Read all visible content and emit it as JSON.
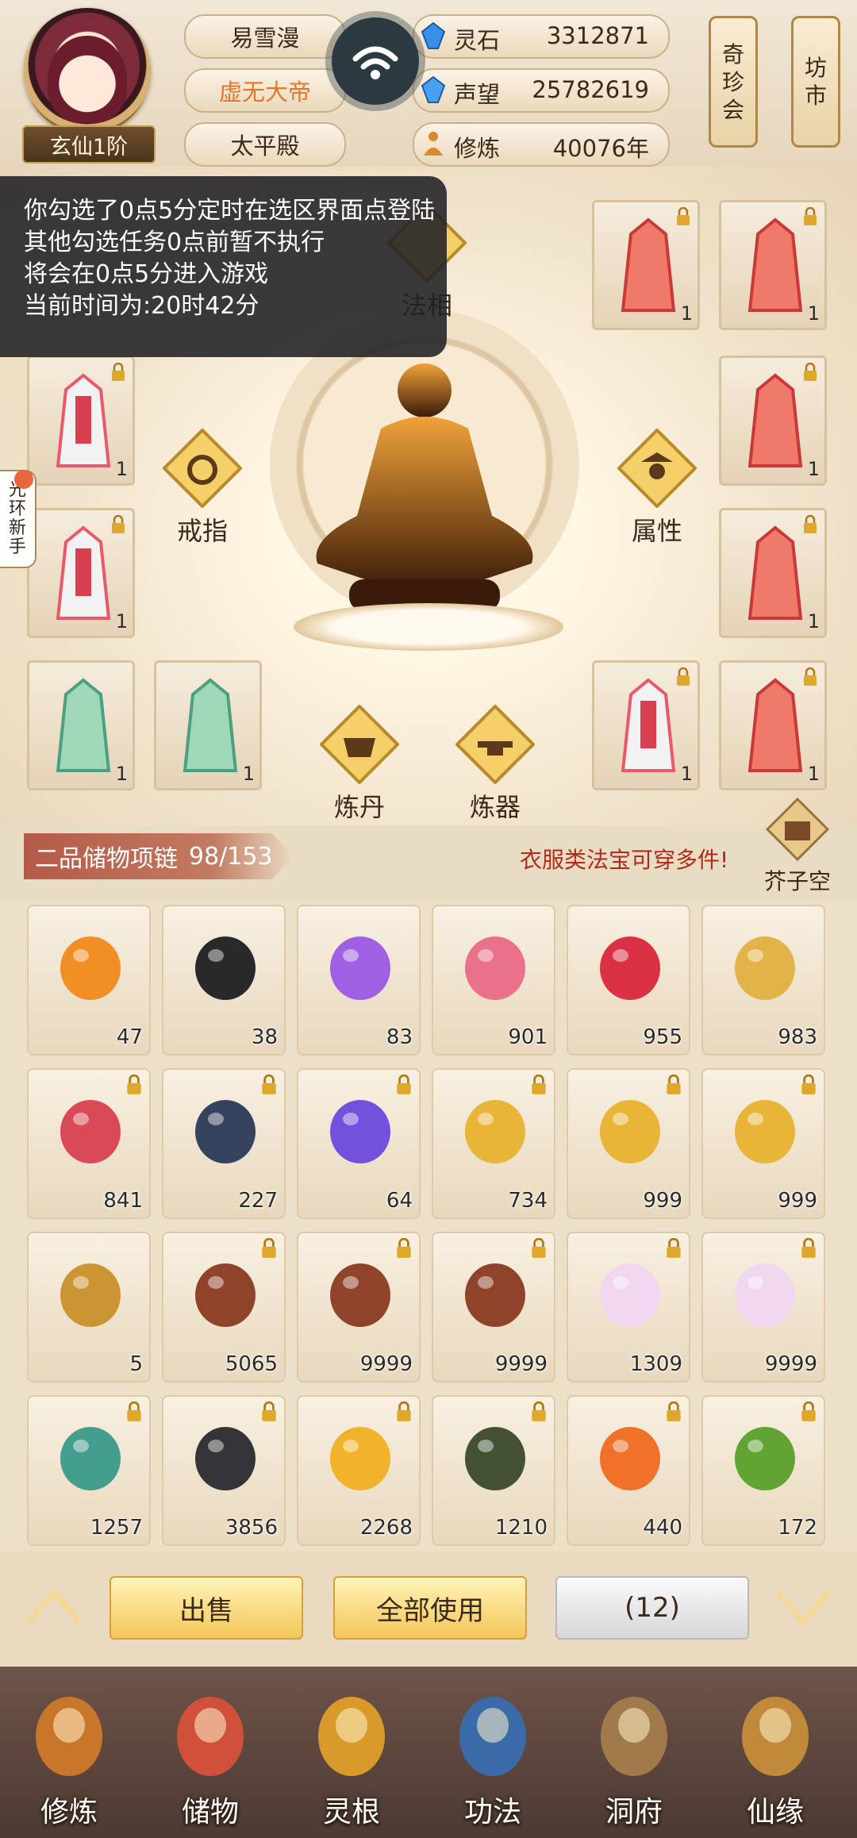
{
  "header": {
    "realm_badge": "玄仙1阶",
    "names": [
      "易雪漫",
      "虚无大帝",
      "太平殿"
    ],
    "stats": [
      {
        "label": "灵石",
        "value": "3312871",
        "icon": "spirit-stone-icon"
      },
      {
        "label": "声望",
        "value": "25782619",
        "icon": "reputation-icon"
      },
      {
        "label": "修炼",
        "value": "40076年",
        "icon": "cultivation-icon"
      }
    ],
    "right_buttons": [
      {
        "label": "奇珍会",
        "chars": [
          "奇",
          "珍",
          "会"
        ]
      },
      {
        "label": "坊市",
        "chars": [
          "坊",
          "市"
        ]
      }
    ],
    "colors": {
      "highlight_name": "#e0782a"
    }
  },
  "notice": {
    "lines": [
      "你勾选了0点5分定时在选区界面点登陆",
      "其他勾选任务0点前暂不执行",
      "将会在0点5分进入游戏",
      "当前时间为:20时42分"
    ]
  },
  "side_tab": {
    "chars": [
      "光",
      "环",
      "新",
      "手"
    ]
  },
  "equipment": {
    "faxiang_label": "法相",
    "diamond_buttons": [
      {
        "label": "戒指",
        "icon": "ring-icon"
      },
      {
        "label": "属性",
        "icon": "attribute-icon"
      },
      {
        "label": "炼丹",
        "icon": "alchemy-cauldron-icon"
      },
      {
        "label": "炼器",
        "icon": "forge-anvil-icon"
      }
    ],
    "left_slots": [
      {
        "count": "1",
        "color": "white-red"
      },
      {
        "count": "1",
        "color": "white-red"
      },
      {
        "count": "1",
        "color": "green"
      },
      {
        "count": "1",
        "color": "green"
      }
    ],
    "right_slots": [
      {
        "count": "1",
        "color": "red"
      },
      {
        "count": "1",
        "color": "red"
      },
      {
        "count": "1",
        "color": "red"
      },
      {
        "count": "1",
        "color": "red"
      },
      {
        "count": "1",
        "color": "white-red"
      },
      {
        "count": "1",
        "color": "red"
      }
    ]
  },
  "inventory": {
    "title": "二品储物项链",
    "capacity": "98/153",
    "tip": "衣服类法宝可穿多件!",
    "mustard_space_label": "芥子空间",
    "items": [
      {
        "name": "fire-orb-icon",
        "count": "47",
        "locked": false,
        "color": "#f08a1c"
      },
      {
        "name": "black-orb-icon",
        "count": "38",
        "locked": false,
        "color": "#1e1e22"
      },
      {
        "name": "purple-crystal-icon",
        "count": "83",
        "locked": false,
        "color": "#9b58e4"
      },
      {
        "name": "pink-fruit-icon",
        "count": "901",
        "locked": false,
        "color": "#e86a86"
      },
      {
        "name": "raspberry-icon",
        "count": "955",
        "locked": false,
        "color": "#d8283c"
      },
      {
        "name": "golden-lotus-icon",
        "count": "983",
        "locked": false,
        "color": "#e0b040"
      },
      {
        "name": "red-peach-icon",
        "count": "841",
        "locked": true,
        "color": "#d84050"
      },
      {
        "name": "taiji-compass-icon",
        "count": "227",
        "locked": true,
        "color": "#2a3a58"
      },
      {
        "name": "violet-gem-icon",
        "count": "64",
        "locked": true,
        "color": "#6a4adc"
      },
      {
        "name": "golden-herb-icon",
        "count": "734",
        "locked": true,
        "color": "#e8b230"
      },
      {
        "name": "golden-herb-icon",
        "count": "999",
        "locked": true,
        "color": "#e8b230"
      },
      {
        "name": "golden-herb-icon",
        "count": "999",
        "locked": true,
        "color": "#e8b230"
      },
      {
        "name": "scroll-icon",
        "count": "5",
        "locked": false,
        "color": "#c8902a"
      },
      {
        "name": "scorpion-icon",
        "count": "5065",
        "locked": true,
        "color": "#8a3a22"
      },
      {
        "name": "scorpion-icon",
        "count": "9999",
        "locked": true,
        "color": "#8a3a22"
      },
      {
        "name": "scorpion-icon",
        "count": "9999",
        "locked": true,
        "color": "#8a3a22"
      },
      {
        "name": "white-flower-icon",
        "count": "1309",
        "locked": true,
        "color": "#f0d6f0"
      },
      {
        "name": "white-flower-icon",
        "count": "9999",
        "locked": true,
        "color": "#f0d6f0"
      },
      {
        "name": "peacock-feather-icon",
        "count": "1257",
        "locked": true,
        "color": "#3a9a8a"
      },
      {
        "name": "dark-rune-stone-icon",
        "count": "3856",
        "locked": true,
        "color": "#2a2a30"
      },
      {
        "name": "amber-crystal-icon",
        "count": "2268",
        "locked": true,
        "color": "#f0b020"
      },
      {
        "name": "green-ore-icon",
        "count": "1210",
        "locked": true,
        "color": "#3a4a2a"
      },
      {
        "name": "flame-stone-icon",
        "count": "440",
        "locked": true,
        "color": "#f06a20"
      },
      {
        "name": "jade-tube-icon",
        "count": "172",
        "locked": true,
        "color": "#5aa02a"
      }
    ]
  },
  "actions": {
    "sell": "出售",
    "use_all": "全部使用",
    "count": "(12)"
  },
  "nav": [
    {
      "label": "修炼",
      "icon": "cultivation-monk-icon"
    },
    {
      "label": "储物",
      "icon": "storage-bag-icon"
    },
    {
      "label": "灵根",
      "icon": "spirit-root-icon"
    },
    {
      "label": "功法",
      "icon": "technique-book-icon"
    },
    {
      "label": "洞府",
      "icon": "cave-mansion-icon"
    },
    {
      "label": "仙缘",
      "icon": "immortal-fate-icon"
    }
  ]
}
